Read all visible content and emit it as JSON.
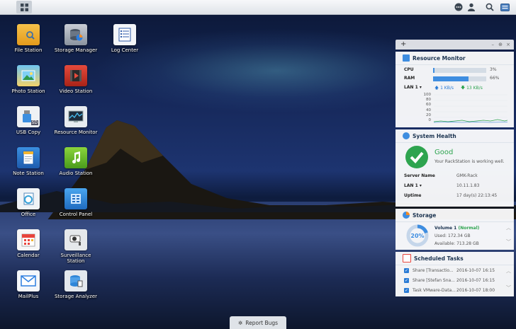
{
  "report": {
    "label": "Report Bugs"
  },
  "desktop": {
    "icons": [
      {
        "label": "File Station"
      },
      {
        "label": "Storage Manager"
      },
      {
        "label": "Log Center"
      },
      {
        "label": "Photo Station"
      },
      {
        "label": "Video Station"
      },
      {
        "label": "USB Copy"
      },
      {
        "label": "Resource Monitor"
      },
      {
        "label": "Note Station"
      },
      {
        "label": "Audio Station"
      },
      {
        "label": "Office"
      },
      {
        "label": "Control Panel"
      },
      {
        "label": "Calendar"
      },
      {
        "label": "Surveillance Station"
      },
      {
        "label": "MailPlus"
      },
      {
        "label": "Storage Analyzer"
      }
    ],
    "usb_sd_badge": "SD"
  },
  "widgets": {
    "resource": {
      "title": "Resource Monitor",
      "cpu_label": "CPU",
      "cpu_value": "3%",
      "cpu_fraction": 0.03,
      "ram_label": "RAM",
      "ram_value": "66%",
      "ram_fraction": 0.66,
      "lan_label": "LAN 1",
      "up": "1 KB/s",
      "down": "13 KB/s",
      "axis": [
        "100",
        "80",
        "60",
        "40",
        "20",
        "0"
      ]
    },
    "health": {
      "title": "System Health",
      "status": "Good",
      "message": "Your RackStation is working well.",
      "rows": [
        {
          "k": "Server Name",
          "v": "GMK-Rack"
        },
        {
          "k": "LAN 1",
          "v": "10.11.1.83"
        },
        {
          "k": "Uptime",
          "v": "17 day(s) 22:13:45"
        }
      ]
    },
    "storage": {
      "title": "Storage",
      "percent": "20%",
      "fraction": 0.2,
      "volume_name": "Volume 1",
      "volume_status": "(Normal)",
      "used": "Used: 172.34 GB",
      "available": "Available: 713.28 GB"
    },
    "tasks": {
      "title": "Scheduled Tasks",
      "items": [
        {
          "name": "Share [Transactio...",
          "time": "2016-10-07 16:15"
        },
        {
          "name": "Share [Stefan Sna...",
          "time": "2016-10-07 16:15"
        },
        {
          "name": "Task VMware-Data...",
          "time": "2016-10-07 18:00"
        }
      ]
    }
  },
  "colors": {
    "accent": "#3e8de0",
    "good": "#2ea44f",
    "upload": "#2a7bd5",
    "download": "#2ea44f"
  }
}
